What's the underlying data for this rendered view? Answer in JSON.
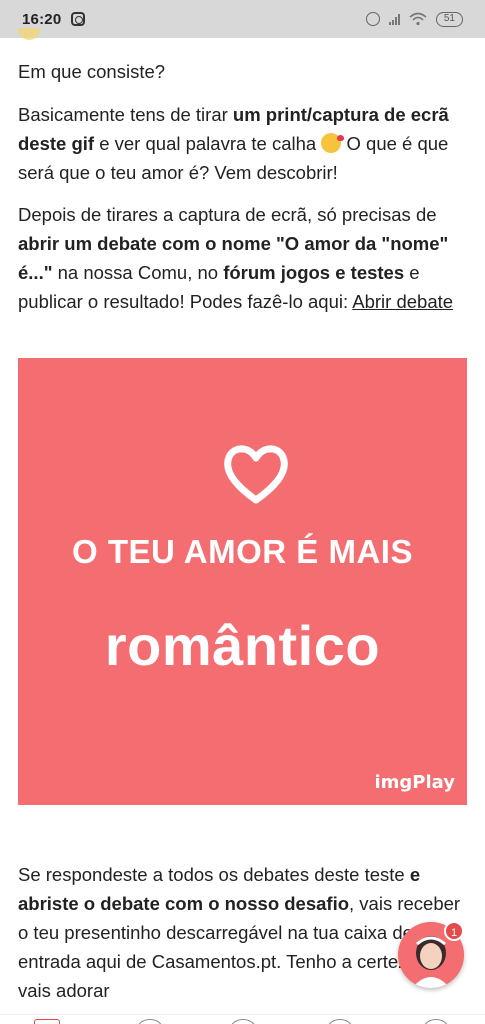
{
  "status_bar": {
    "time": "16:20",
    "battery": "51"
  },
  "article": {
    "heading": "Em que consiste?",
    "p1": {
      "t1": "Basicamente tens de tirar ",
      "b1": "um print/captura de ecrã deste gif",
      "t2": " e ver qual palavra te calha ",
      "t3": " O que é que será que o teu amor é? Vem descobrir!"
    },
    "p2": {
      "t1": "Depois de tirares a captura de ecrã, só precisas de ",
      "b1": "abrir um debate com o nome \"O amor da \"nome\" é...\"",
      "t2": " na nossa Comu, no ",
      "b2": "fórum jogos e testes",
      "t3": " e publicar o resultado! Podes fazê-lo aqui: ",
      "link": "Abrir debate"
    },
    "gif": {
      "line1": "O TEU AMOR É MAIS",
      "line2": "romântico",
      "watermark": "imgPlay"
    },
    "p3": {
      "t1": "Se respondeste a todos os debates deste teste ",
      "b1": "e abriste o debate com o nosso desafio",
      "t2": ", vais receber o teu presentinho descarregável na tua caixa de entrada aqui de Casamentos.pt. Tenho a certeza que vais adorar"
    }
  },
  "floating": {
    "badge_count": "1"
  },
  "colors": {
    "gif_background": "#f46d70",
    "accent": "#e64a4a"
  }
}
